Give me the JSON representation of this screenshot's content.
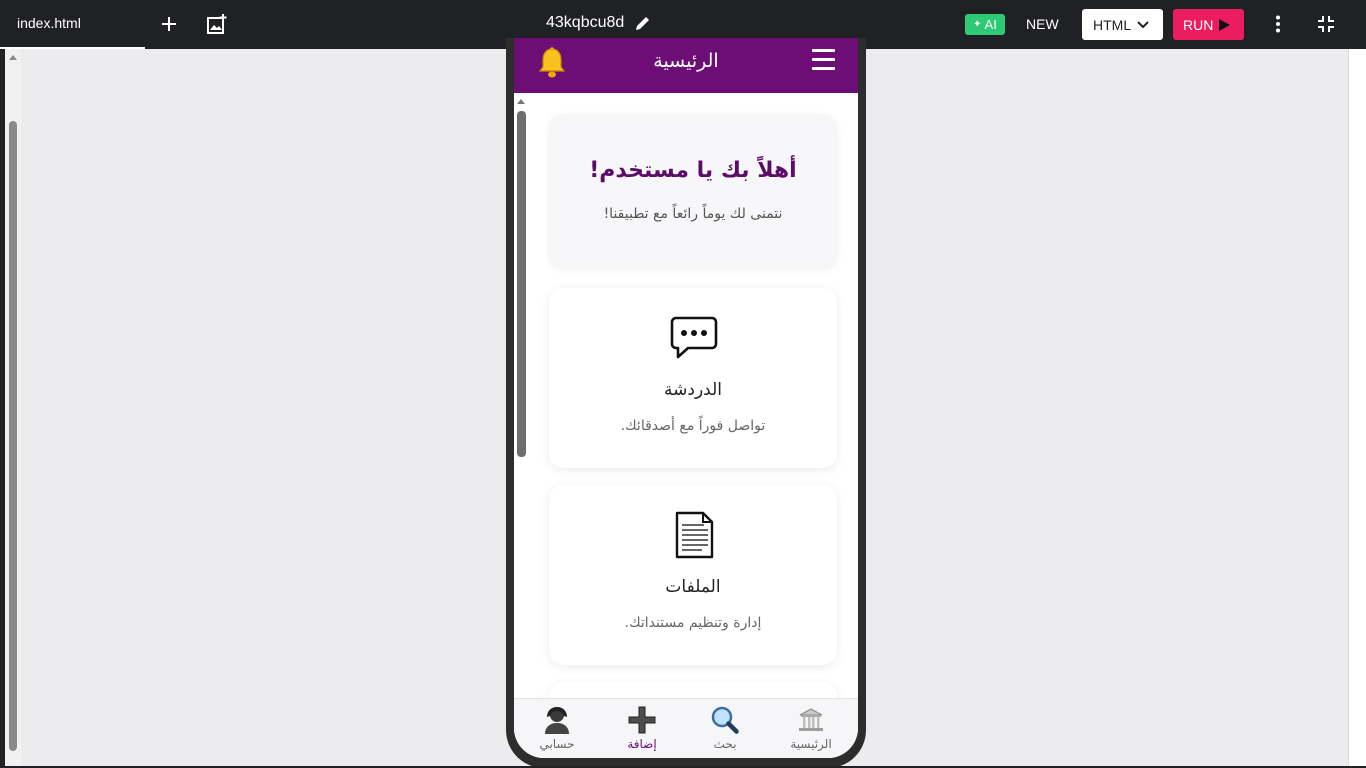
{
  "editor": {
    "file_tab": "index.html",
    "project_name": "43kqbcu8d",
    "ai_label": "AI",
    "new_label": "NEW",
    "language": "HTML",
    "run_label": "RUN"
  },
  "app": {
    "header_title": "الرئيسية",
    "welcome": {
      "title": "أهلاً بك يا مستخدم!",
      "subtitle": "نتمنى لك يوماً رائعاً مع تطبيقنا!"
    },
    "cards": [
      {
        "icon": "chat-bubble-icon",
        "title": "الدردشة",
        "desc": "تواصل فوراً مع أصدقائك."
      },
      {
        "icon": "document-icon",
        "title": "الملفات",
        "desc": "إدارة وتنظيم مستنداتك."
      }
    ],
    "nav": [
      {
        "icon": "user-icon",
        "label": "حسابي"
      },
      {
        "icon": "plus-icon",
        "label": "إضافة"
      },
      {
        "icon": "search-icon",
        "label": "بحث"
      },
      {
        "icon": "home-icon",
        "label": "الرئيسية"
      }
    ],
    "colors": {
      "primary": "#6c0e75",
      "run": "#ec1c60",
      "ai": "#2ec974"
    }
  }
}
